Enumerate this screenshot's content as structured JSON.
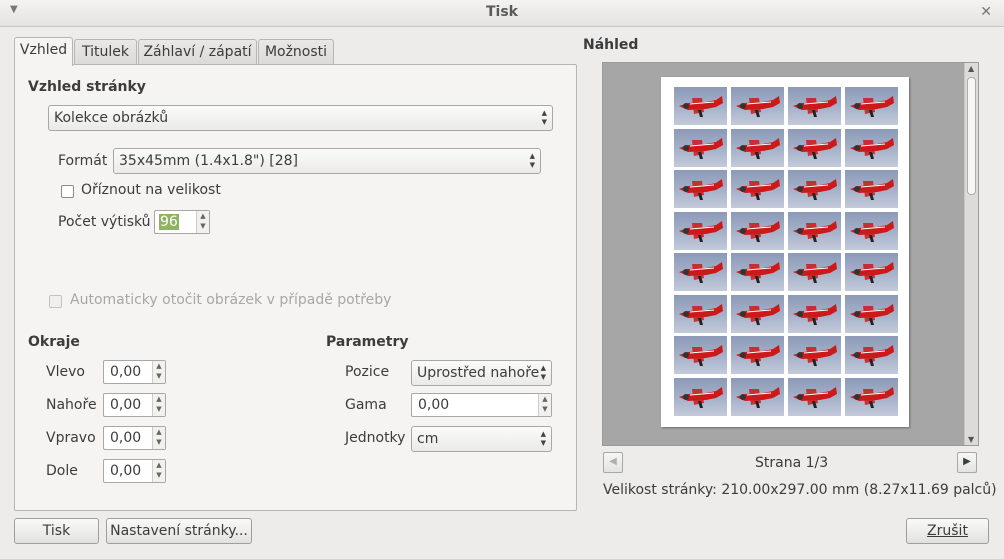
{
  "window": {
    "title": "Tisk"
  },
  "tabs": [
    {
      "label": "Vzhled",
      "active": true
    },
    {
      "label": "Titulek"
    },
    {
      "label": "Záhlaví / zápatí"
    },
    {
      "label": "Možnosti"
    }
  ],
  "layout": {
    "section_title": "Vzhled stránky",
    "layout_value": "Kolekce obrázků",
    "format_label": "Formát",
    "format_value": "35x45mm (1.4x1.8\") [28]",
    "crop_label": "Oříznout na velikost",
    "crop_checked": false,
    "copies_label": "Počet výtisků",
    "copies_value": "96",
    "autorotate_label": "Automaticky otočit obrázek v případě potřeby",
    "autorotate_checked": false
  },
  "margins": {
    "title": "Okraje",
    "left_label": "Vlevo",
    "left_value": "0,00",
    "top_label": "Nahoře",
    "top_value": "0,00",
    "right_label": "Vpravo",
    "right_value": "0,00",
    "bottom_label": "Dole",
    "bottom_value": "0,00"
  },
  "params": {
    "title": "Parametry",
    "position_label": "Pozice",
    "position_value": "Uprostřed nahoře",
    "gamma_label": "Gama",
    "gamma_value": "0,00",
    "units_label": "Jednotky",
    "units_value": "cm"
  },
  "preview": {
    "title": "Náhled",
    "page_label": "Strana 1/3",
    "page_size": "Velikost stránky: 210.00x297.00 mm (8.27x11.69 palců)",
    "grid_cols": 4,
    "grid_rows": 8
  },
  "buttons": {
    "print": "Tisk",
    "page_setup": "Nastavení stránky...",
    "cancel": "Zrušit"
  },
  "icons": {
    "window_menu": "chevron-down-icon",
    "close": "close-icon",
    "prev": "arrow-left-icon",
    "next": "arrow-right-icon"
  },
  "colors": {
    "highlight_green": "#8fb360",
    "plane_red": "#cc1a1a"
  }
}
